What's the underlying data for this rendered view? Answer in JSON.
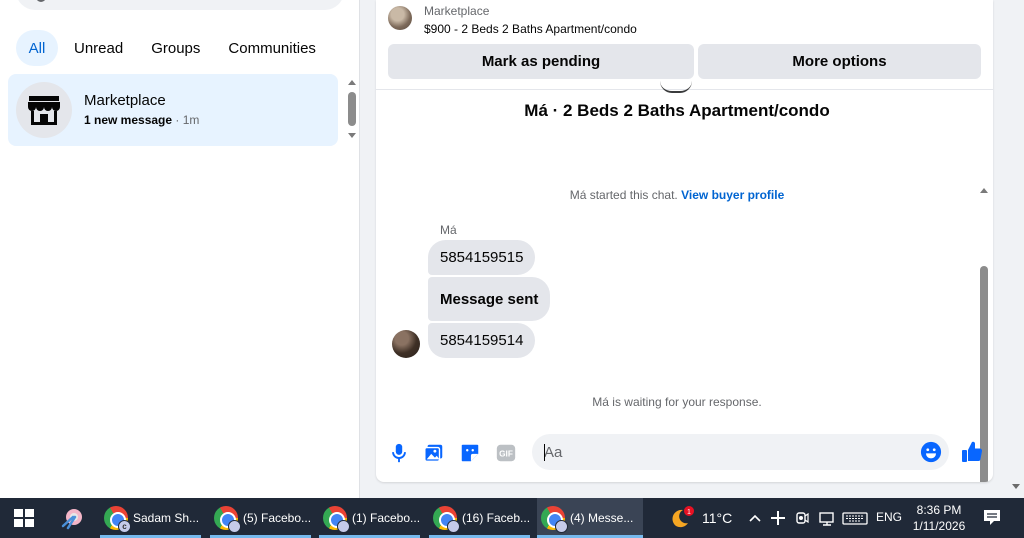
{
  "sidebar": {
    "filters": [
      {
        "label": "All"
      },
      {
        "label": "Unread"
      },
      {
        "label": "Groups"
      },
      {
        "label": "Communities"
      }
    ],
    "conversation": {
      "name": "Marketplace",
      "preview": "1 new message",
      "time": "· 1m"
    }
  },
  "listing": {
    "source": "Marketplace",
    "title": "$900 - 2 Beds 2 Baths Apartment/condo",
    "pending_label": "Mark as pending",
    "more_label": "More options"
  },
  "chat": {
    "title": "Má · 2 Beds 2 Baths Apartment/condo",
    "started_text": "Má started this chat.",
    "profile_link": "View buyer profile",
    "sender": "Má",
    "messages": [
      {
        "text": "5854159515"
      },
      {
        "text": "Message sent"
      },
      {
        "text": "5854159514"
      }
    ],
    "waiting_text": "Má is waiting for your response."
  },
  "composer": {
    "placeholder": "Aa",
    "accent_color": "#0866ff"
  },
  "taskbar": {
    "tasks": [
      {
        "label": "Sadam Sh...",
        "badge": "c"
      },
      {
        "label": "(5) Facebo...",
        "badge": ""
      },
      {
        "label": "(1) Facebo...",
        "badge": ""
      },
      {
        "label": "(16) Faceb...",
        "badge": ""
      },
      {
        "label": "(4) Messe...",
        "badge": ""
      }
    ],
    "weather_badge": "1",
    "temperature": "11°C",
    "language": "ENG",
    "time": "8:36 PM",
    "date": "1/11/2026"
  }
}
